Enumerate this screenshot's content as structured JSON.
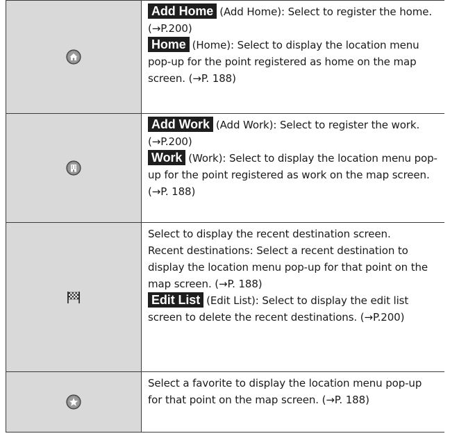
{
  "rows": [
    {
      "icon": "home-icon",
      "items": [
        {
          "badge": "Add Home",
          "text": "(Add Home): Select to register the home. (→P.200)"
        },
        {
          "badge": "Home",
          "text": "(Home): Select to display the location menu pop-up for the point registered as home on the map screen. (→P. 188)"
        }
      ]
    },
    {
      "icon": "work-icon",
      "items": [
        {
          "badge": "Add Work",
          "text": "(Add Work): Select to register the work. (→P.200)"
        },
        {
          "badge": "Work",
          "text": "(Work): Select to display the location menu pop-up for the point registered as work on the map screen. (→P. 188)"
        }
      ]
    },
    {
      "icon": "checkered-flag-icon",
      "items": [
        {
          "badge": "",
          "text": "Select to display the recent destination screen."
        },
        {
          "badge": "",
          "text": "Recent destinations: Select a recent destination to display the location menu pop-up for that point on the map screen. (→P. 188)"
        },
        {
          "badge": "Edit List",
          "text": "(Edit List): Select to display the edit list screen to delete the recent destinations. (→P.200)"
        }
      ]
    },
    {
      "icon": "star-icon",
      "items": [
        {
          "badge": "",
          "text": "Select a favorite to display the location menu pop-up for that point on the map screen. (→P. 188)"
        }
      ]
    }
  ],
  "colors": {
    "icon_bg": "#d9d9d9",
    "badge_bg": "#1e1e1e",
    "border": "#3a3a3a"
  }
}
